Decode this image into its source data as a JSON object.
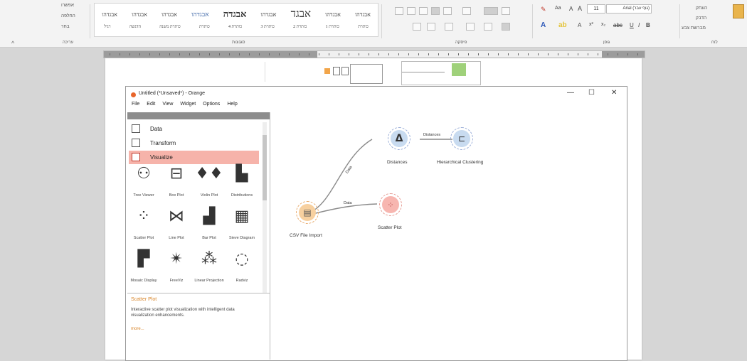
{
  "ribbon": {
    "left_items": [
      "אפשרו",
      "החלפה",
      "בחר"
    ],
    "left_group": "עריכה",
    "styles_row1": [
      "אבגדהו",
      "אבגדהו",
      "אבגד",
      "אבגדהו",
      "אבגדה",
      "אבגדהו",
      "אבגדהו",
      "אבגדהו",
      "אבגדהו"
    ],
    "styles_row2": [
      "כותרת",
      "כותרת 1",
      "כותרת 2",
      "כותרת 3",
      "כותרת 4",
      "כותרת",
      "כותרת משנה",
      "הדגשה",
      "רגיל"
    ],
    "styles_group": "סגנונות",
    "paragraph_group": "פיסקה",
    "font_group": "גופן",
    "font_size": "11",
    "font_name": "Arial (גוף עבר)",
    "right_items": [
      "העתק",
      "הדבק",
      "מברשת צבע"
    ],
    "clipboard_group": "לוח"
  },
  "orange": {
    "title": "Untitled (*Unsaved*) - Orange",
    "menu": [
      "File",
      "Edit",
      "View",
      "Widget",
      "Options",
      "Help"
    ],
    "window_controls": {
      "minimize": "—",
      "maximize": "☐",
      "close": "✕"
    },
    "categories": [
      "Data",
      "Transform",
      "Visualize"
    ],
    "widgets": [
      {
        "label": "Tree Viewer",
        "icon": "tree-viewer-icon",
        "glyph": "⚇"
      },
      {
        "label": "Box Plot",
        "icon": "box-plot-icon",
        "glyph": "⊟"
      },
      {
        "label": "Violin Plot",
        "icon": "violin-plot-icon",
        "glyph": "♦♦"
      },
      {
        "label": "Distributions",
        "icon": "distributions-icon",
        "glyph": "▙"
      },
      {
        "label": "Scatter Plot",
        "icon": "scatter-plot-icon",
        "glyph": "⁘"
      },
      {
        "label": "Line Plot",
        "icon": "line-plot-icon",
        "glyph": "⋈"
      },
      {
        "label": "Bar Plot",
        "icon": "bar-plot-icon",
        "glyph": "▟"
      },
      {
        "label": "Sieve Diagram",
        "icon": "sieve-diagram-icon",
        "glyph": "▦"
      },
      {
        "label": "Mosaic Display",
        "icon": "mosaic-display-icon",
        "glyph": "▛"
      },
      {
        "label": "FreeViz",
        "icon": "freeviz-icon",
        "glyph": "✴"
      },
      {
        "label": "Linear Projection",
        "icon": "linear-projection-icon",
        "glyph": "⁂"
      },
      {
        "label": "Radviz",
        "icon": "radviz-icon",
        "glyph": "◌"
      }
    ],
    "info": {
      "title": "Scatter Plot",
      "description": "Interactive scatter plot visualization with intelligent data visualization enhancements.",
      "more": "more..."
    },
    "nodes": {
      "csv": "CSV File Import",
      "distances": "Distances",
      "hier": "Hierarchical Clustering",
      "scatter": "Scatter Plot"
    },
    "edges": {
      "csv_dist": "Data",
      "csv_scatter": "Data",
      "dist_hier": "Distances"
    },
    "colors": {
      "data_node": "#f7d09f",
      "distance_node": "#c8dbf0",
      "viz_node": "#f7b6b0",
      "selected_category": "#f6b3aa"
    }
  }
}
